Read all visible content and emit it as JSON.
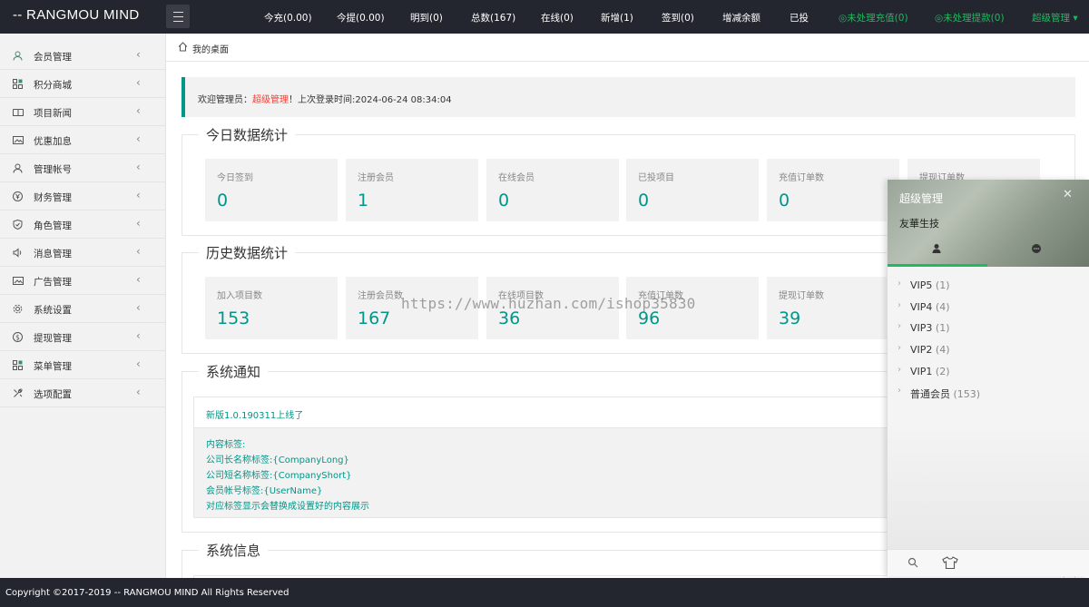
{
  "logo": "-- RANGMOU MIND",
  "topnav": [
    {
      "label": "今充(0.00)"
    },
    {
      "label": "今提(0.00)"
    },
    {
      "label": "明到(0)"
    },
    {
      "label": "总数(167)"
    },
    {
      "label": "在线(0)"
    },
    {
      "label": "新增(1)"
    },
    {
      "label": "签到(0)"
    },
    {
      "label": "增减余额"
    },
    {
      "label": "已投"
    },
    {
      "label": "◎未处理充值(0)"
    },
    {
      "label": "◎未处理提款(0)"
    },
    {
      "label": "超级管理 ▾"
    }
  ],
  "sidebar": {
    "items": [
      {
        "label": "会员管理",
        "icon": "user-icon"
      },
      {
        "label": "积分商城",
        "icon": "grid-icon"
      },
      {
        "label": "项目新闻",
        "icon": "book-icon"
      },
      {
        "label": "优惠加息",
        "icon": "image-icon"
      },
      {
        "label": "管理帐号",
        "icon": "user-group-icon"
      },
      {
        "label": "财务管理",
        "icon": "yen-icon"
      },
      {
        "label": "角色管理",
        "icon": "shield-icon"
      },
      {
        "label": "消息管理",
        "icon": "speaker-icon"
      },
      {
        "label": "广告管理",
        "icon": "image-icon"
      },
      {
        "label": "系统设置",
        "icon": "gear-icon"
      },
      {
        "label": "提现管理",
        "icon": "dollar-icon"
      },
      {
        "label": "菜单管理",
        "icon": "grid-icon"
      },
      {
        "label": "选项配置",
        "icon": "tools-icon"
      }
    ]
  },
  "breadcrumb": "我的桌面",
  "welcome": {
    "prefix": "欢迎管理员：",
    "role": "超级管理",
    "suffix": "！上次登录时间:2024-06-24 08:34:04"
  },
  "today": {
    "title": "今日数据统计",
    "stats": [
      {
        "label": "今日签到",
        "value": "0"
      },
      {
        "label": "注册会员",
        "value": "1"
      },
      {
        "label": "在线会员",
        "value": "0"
      },
      {
        "label": "已投项目",
        "value": "0"
      },
      {
        "label": "充值订单数",
        "value": "0"
      },
      {
        "label": "提现订单数",
        "value": ""
      }
    ]
  },
  "history": {
    "title": "历史数据统计",
    "stats": [
      {
        "label": "加入项目数",
        "value": "153"
      },
      {
        "label": "注册会员数",
        "value": "167"
      },
      {
        "label": "在线项目数",
        "value": "36"
      },
      {
        "label": "充值订单数",
        "value": "96"
      },
      {
        "label": "提现订单数",
        "value": "39"
      }
    ]
  },
  "notice": {
    "title": "系统通知",
    "headline": "新版1.0.190311上线了",
    "lines": [
      "内容标签:",
      "公司长名称标签:{CompanyLong}",
      "公司短名称标签:{CompanyShort}",
      "会员帐号标签:{UserName}",
      "对应标签显示会替换成设置好的内容展示"
    ]
  },
  "sysinfo": {
    "title": "系统信息"
  },
  "watermark": "https://www.huzhan.com/ishop35830",
  "footer": "Copyright ©2017-2019 -- RANGMOU MIND All Rights Reserved",
  "chat": {
    "name": "超级管理",
    "sign": "友華生技",
    "groups": [
      {
        "name": "VIP5",
        "count": "(1)"
      },
      {
        "name": "VIP4",
        "count": "(4)"
      },
      {
        "name": "VIP3",
        "count": "(1)"
      },
      {
        "name": "VIP2",
        "count": "(4)"
      },
      {
        "name": "VIP1",
        "count": "(2)"
      },
      {
        "name": "普通会员",
        "count": "(153)"
      }
    ]
  },
  "colors": {
    "accent": "#009688",
    "header": "#23262e",
    "green": "#1fb95f",
    "red": "#ff3b30"
  }
}
